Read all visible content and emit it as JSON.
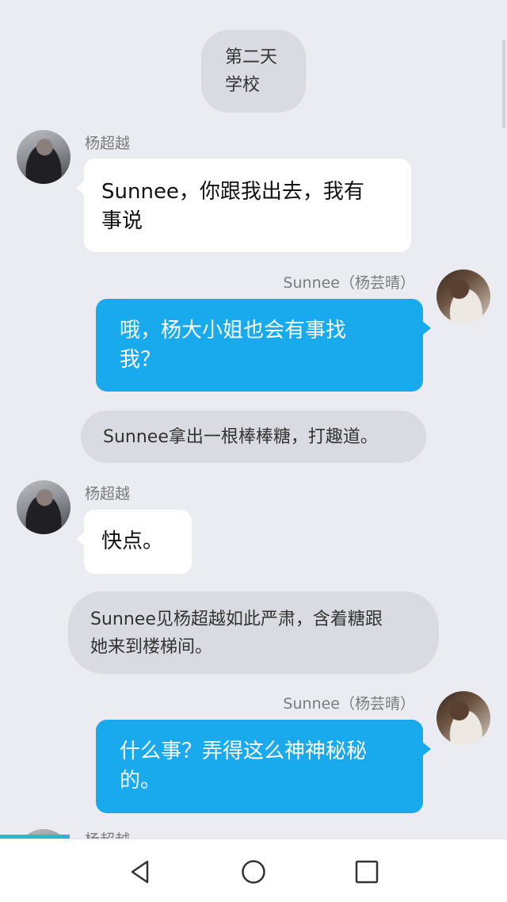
{
  "chat": {
    "time_label": "第二天\n学校",
    "messages": [
      {
        "kind": "left",
        "sender": "杨超越",
        "text": "Sunnee，你跟我出去，我有\n事说"
      },
      {
        "kind": "right",
        "sender": "Sunnee（杨芸晴）",
        "text": "哦，杨大小姐也会有事找\n我？"
      },
      {
        "kind": "narration",
        "text": "Sunnee拿出一根棒棒糖，打趣道。"
      },
      {
        "kind": "left",
        "sender": "杨超越",
        "text": "快点。"
      },
      {
        "kind": "narration",
        "text": "Sunnee见杨超越如此严肃，含着糖跟\n她来到楼梯间。"
      },
      {
        "kind": "right",
        "sender": "Sunnee（杨芸晴）",
        "text": "什么事？弄得这么神神秘秘\n的。"
      },
      {
        "kind": "left",
        "sender": "杨超越",
        "text": ""
      }
    ]
  },
  "colors": {
    "background": "#ebecf1",
    "bubble_self": "#18aaec",
    "bubble_other": "#ffffff",
    "narration": "#d9dae2"
  },
  "nav": {
    "back": "back-triangle",
    "home": "home-circle",
    "recents": "recents-square"
  }
}
